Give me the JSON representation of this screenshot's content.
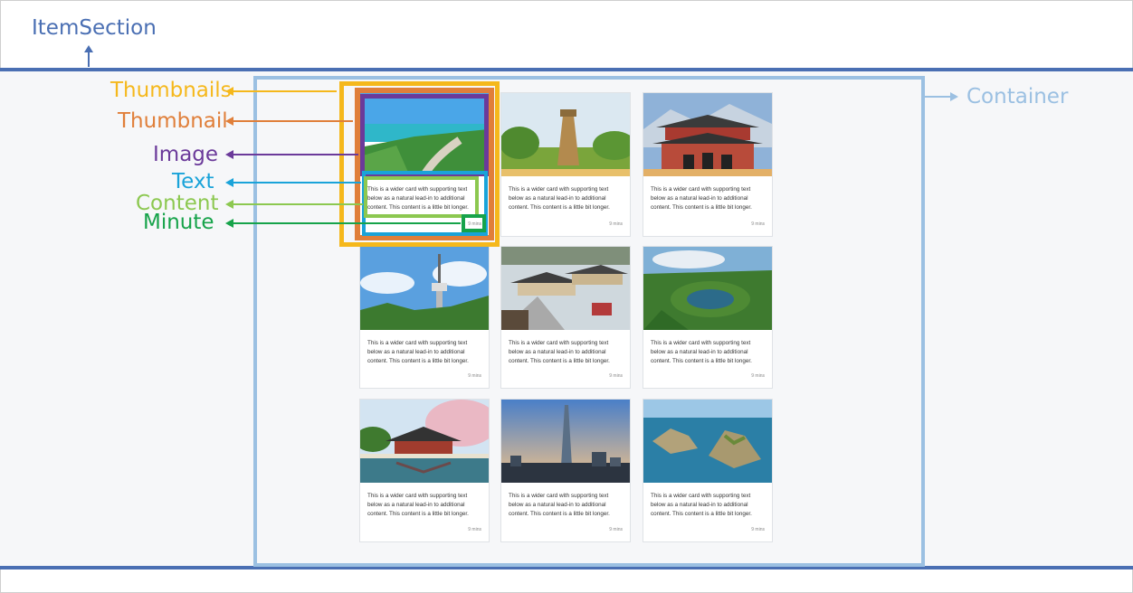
{
  "labels": {
    "item_section": "ItemSection",
    "container": "Container",
    "thumbnails": "Thumbnails",
    "thumbnail": "Thumbnail",
    "image": "Image",
    "text": "Text",
    "content": "Content",
    "minute": "Minute"
  },
  "colors": {
    "item_section": "#4a6fb3",
    "container": "#9bc0e2",
    "thumbnails": "#f5b81c",
    "thumbnail": "#e07f3a",
    "image": "#6b3a9a",
    "text": "#1aa3d9",
    "content": "#8cc850",
    "minute": "#16a34a"
  },
  "cards": [
    {
      "scene": "coast-path-icon",
      "content": "This is a wider card with supporting text below as a natural lead-in to additional content. This content is a little bit longer.",
      "minute": "9 mins"
    },
    {
      "scene": "stone-observatory-icon",
      "content": "This is a wider card with supporting text below as a natural lead-in to additional content. This content is a little bit longer.",
      "minute": "9 mins"
    },
    {
      "scene": "palace-gate-icon",
      "content": "This is a wider card with supporting text below as a natural lead-in to additional content. This content is a little bit longer.",
      "minute": "9 mins"
    },
    {
      "scene": "tower-sky-icon",
      "content": "This is a wider card with supporting text below as a natural lead-in to additional content. This content is a little bit longer.",
      "minute": "9 mins"
    },
    {
      "scene": "hanok-village-icon",
      "content": "This is a wider card with supporting text below as a natural lead-in to additional content. This content is a little bit longer.",
      "minute": "9 mins"
    },
    {
      "scene": "crater-lake-icon",
      "content": "This is a wider card with supporting text below as a natural lead-in to additional content. This content is a little bit longer.",
      "minute": "9 mins"
    },
    {
      "scene": "pavilion-blossom-icon",
      "content": "This is a wider card with supporting text below as a natural lead-in to additional content. This content is a little bit longer.",
      "minute": "9 mins"
    },
    {
      "scene": "skyscraper-city-icon",
      "content": "This is a wider card with supporting text below as a natural lead-in to additional content. This content is a little bit longer.",
      "minute": "9 mins"
    },
    {
      "scene": "rocky-islets-icon",
      "content": "This is a wider card with supporting text below as a natural lead-in to additional content. This content is a little bit longer.",
      "minute": "9 mins"
    }
  ]
}
